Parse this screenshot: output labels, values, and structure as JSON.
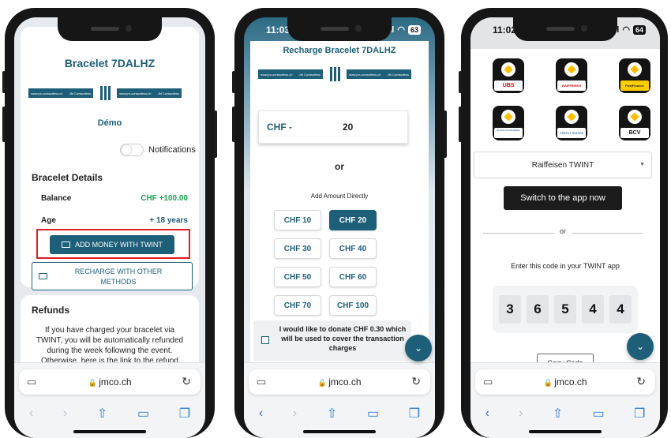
{
  "phone1": {
    "title": "Bracelet 7DALHZ",
    "logo_text_left": "www.jm-contactless.ch",
    "logo_brand": "JM Contactless",
    "mode": "Démo",
    "notifications_label": "Notifications",
    "details_heading": "Bracelet Details",
    "balance_label": "Balance",
    "balance_value": "CHF +100.00",
    "age_label": "Age",
    "age_value": "+ 18 years",
    "add_twint_label": "ADD MONEY WITH TWINT",
    "recharge_other_label": "RECHARGE WITH OTHER METHODS",
    "refunds_heading": "Refunds",
    "refunds_text": "If you have charged your bracelet via TWINT, you will be automatically refunded during the week following the event. Otherwise, here is the link to the refund form:",
    "url": "jmco.ch",
    "highlight_color": "#e01c24"
  },
  "phone2": {
    "time": "11:03",
    "battery": "63",
    "title": "Recharge Bracelet 7DALHZ",
    "currency": "CHF -",
    "amount": "20",
    "or_label": "or",
    "add_directly_label": "Add Amount Directly",
    "amounts": [
      "CHF 10",
      "CHF 20",
      "CHF 30",
      "CHF 40",
      "CHF 50",
      "CHF 60",
      "CHF 70",
      "CHF 100"
    ],
    "selected_amount": "CHF 20",
    "donate_text": "I would like to donate CHF 0.30 which will be used to cover the transaction charges",
    "url": "jmco.ch"
  },
  "phone3": {
    "time": "11:02",
    "battery": "64",
    "banks": [
      "UBS",
      "RAIFFEISEN",
      "PostFinance",
      "Zürcher Kantonalbank",
      "CREDIT SUISSE",
      "BCV"
    ],
    "selected_bank": "Raiffeisen TWINT",
    "switch_label": "Switch to the app now",
    "or_label": "or",
    "code_prompt": "Enter this code in your TWINT app",
    "code_digits": [
      "3",
      "6",
      "5",
      "4",
      "4"
    ],
    "copy_label": "Copy Code",
    "url": "jmco.ch"
  }
}
